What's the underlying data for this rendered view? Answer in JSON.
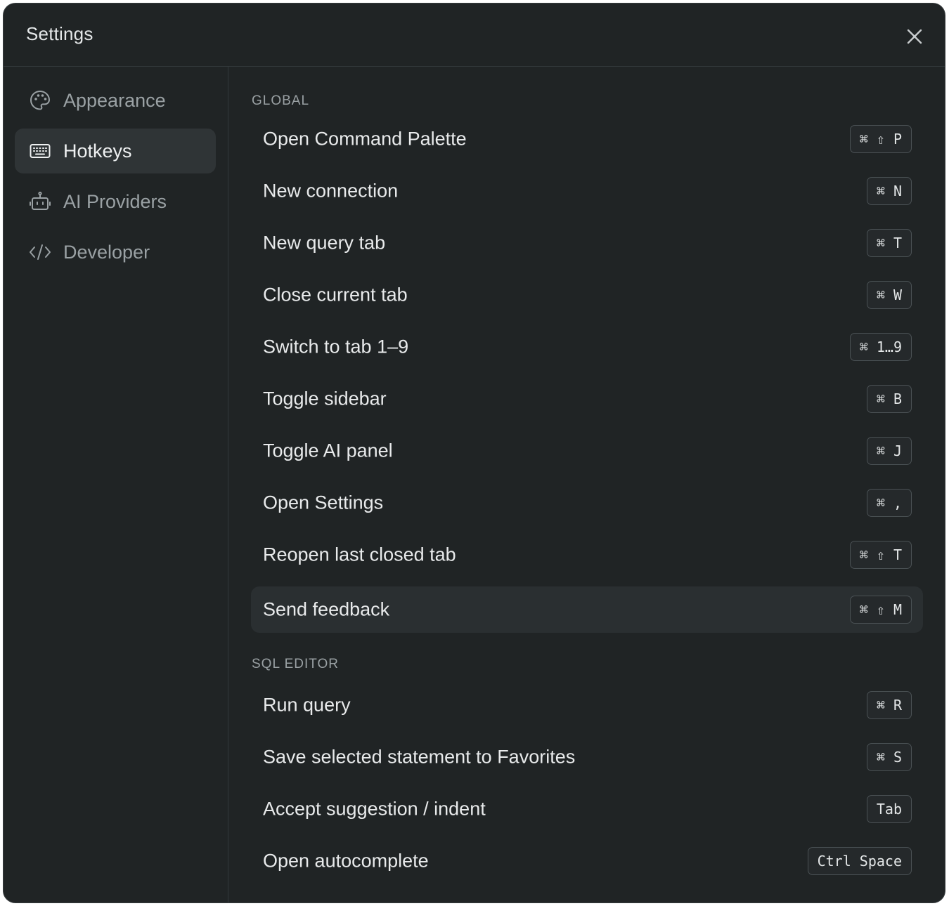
{
  "window": {
    "title": "Settings"
  },
  "sidebar": {
    "items": [
      {
        "label": "Appearance",
        "icon": "palette-icon",
        "active": false
      },
      {
        "label": "Hotkeys",
        "icon": "keyboard-icon",
        "active": true
      },
      {
        "label": "AI Providers",
        "icon": "robot-icon",
        "active": false
      },
      {
        "label": "Developer",
        "icon": "code-icon",
        "active": false
      }
    ]
  },
  "sections": {
    "global": {
      "label": "GLOBAL",
      "rows": [
        {
          "label": "Open Command Palette",
          "keys": "⌘ ⇧ P"
        },
        {
          "label": "New connection",
          "keys": "⌘ N"
        },
        {
          "label": "New query tab",
          "keys": "⌘ T"
        },
        {
          "label": "Close current tab",
          "keys": "⌘ W"
        },
        {
          "label": "Switch to tab 1–9",
          "keys": "⌘ 1…9"
        },
        {
          "label": "Toggle sidebar",
          "keys": "⌘ B"
        },
        {
          "label": "Toggle AI panel",
          "keys": "⌘ J"
        },
        {
          "label": "Open Settings",
          "keys": "⌘ ,"
        },
        {
          "label": "Reopen last closed tab",
          "keys": "⌘ ⇧ T"
        },
        {
          "label": "Send feedback",
          "keys": "⌘ ⇧ M"
        }
      ]
    },
    "sql_editor": {
      "label": "SQL EDITOR",
      "rows": [
        {
          "label": "Run query",
          "keys": "⌘ R"
        },
        {
          "label": "Save selected statement to Favorites",
          "keys": "⌘ S"
        },
        {
          "label": "Accept suggestion / indent",
          "keys": "Tab"
        },
        {
          "label": "Open autocomplete",
          "keys": "Ctrl Space"
        }
      ]
    }
  },
  "colors": {
    "background": "#202425",
    "active_item": "#2f3436",
    "highlight_row": "#2a2f31",
    "text_primary": "#e8eaeb",
    "text_muted": "#9aa1a4",
    "border": "#33393b"
  }
}
